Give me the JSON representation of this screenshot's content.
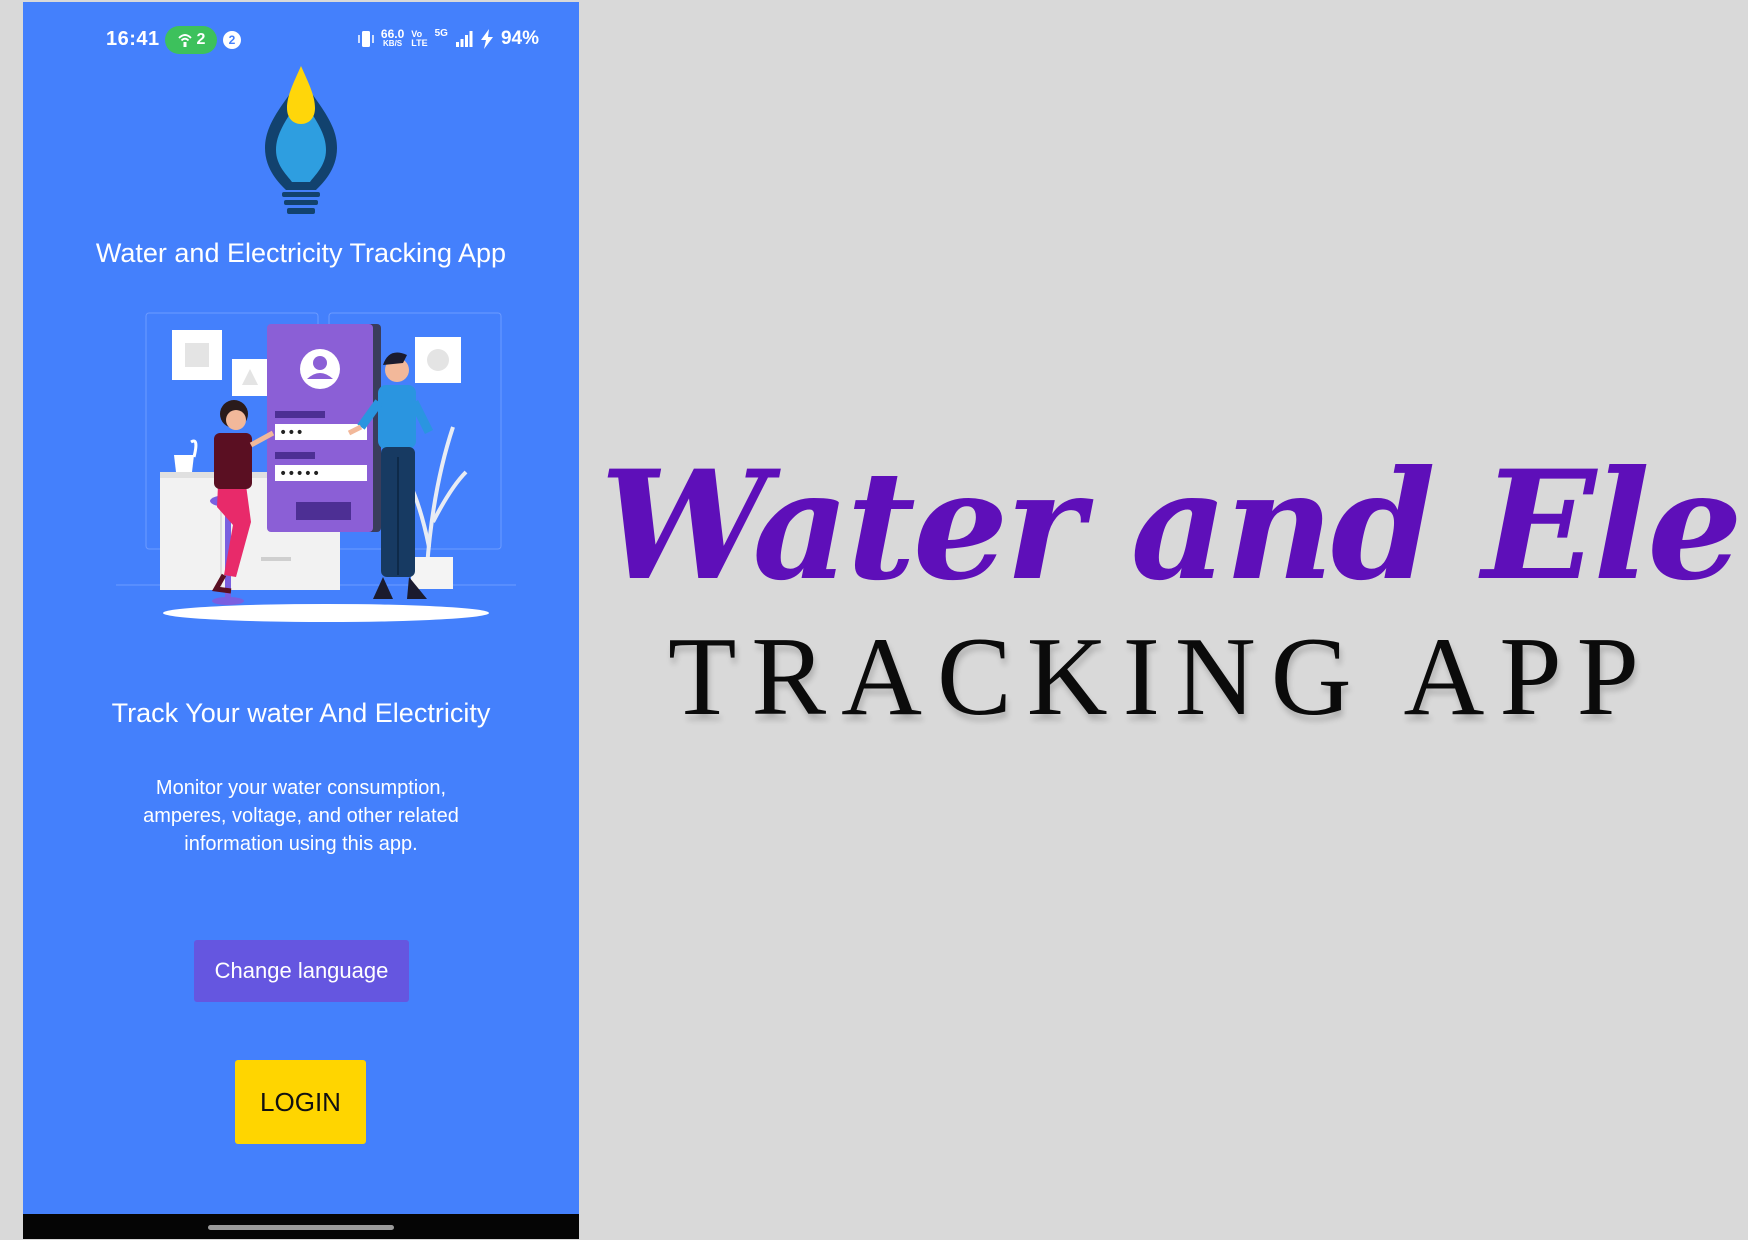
{
  "status_bar": {
    "time": "16:41",
    "hotspot_count": "2",
    "notification_count": "2",
    "net_speed": "66.0",
    "net_speed_unit": "KB/S",
    "volte_top": "Vo",
    "volte_bottom": "LTE",
    "network": "5G",
    "battery": "94%",
    "icons": [
      "hotspot-icon",
      "vibrate-icon",
      "signal-icon",
      "charging-icon"
    ]
  },
  "app": {
    "title": "Water and Electricity Tracking App",
    "tagline": "Track Your water And Electricity",
    "description": "Monitor your water consumption, amperes, voltage, and other related information using this app.",
    "change_language_label": "Change language",
    "login_label": "LOGIN",
    "login_dots_short": "•••",
    "login_dots_long": "•••••"
  },
  "promo": {
    "title": "Water and Ele.",
    "subtitle": "TRACKING APP"
  },
  "colors": {
    "phone_bg": "#4480fc",
    "change_language_bg": "#6556e0",
    "login_bg": "#ffd500",
    "promo_title": "#5e0fb9",
    "page_bg": "#d9d9d9"
  }
}
